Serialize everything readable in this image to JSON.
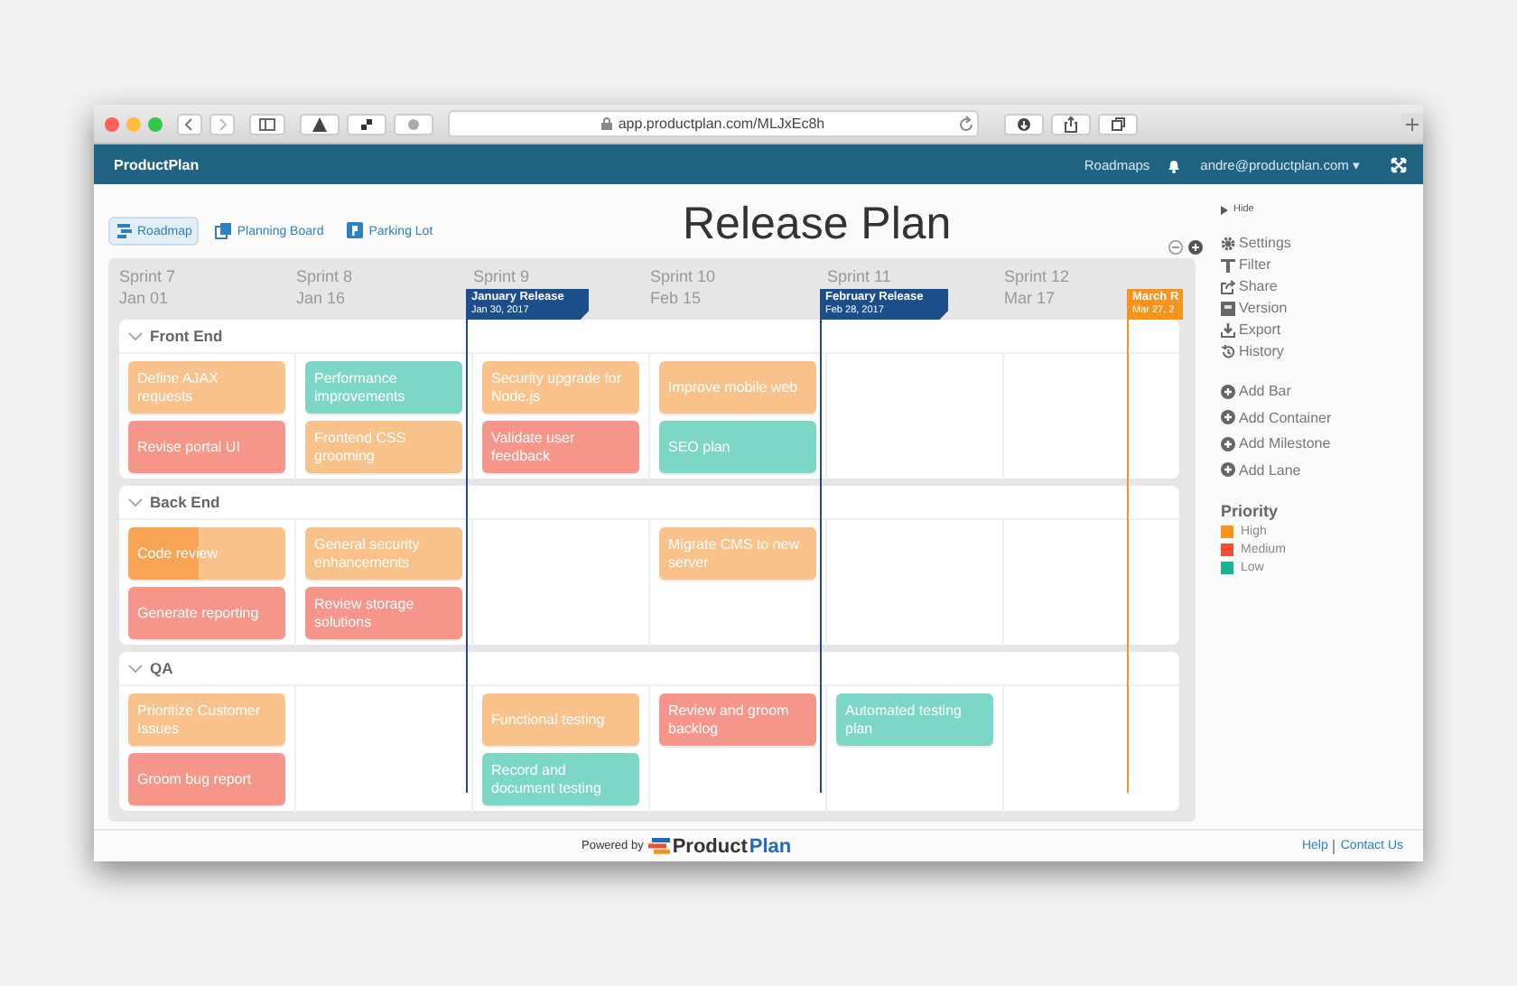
{
  "browser": {
    "url": "app.productplan.com/MLJxEc8h"
  },
  "navbar": {
    "brand": "ProductPlan",
    "links": [
      "Roadmaps"
    ],
    "user": "andre@productplan.com ▾"
  },
  "views": [
    {
      "label": "Roadmap",
      "selected": true
    },
    {
      "label": "Planning Board",
      "selected": false
    },
    {
      "label": "Parking Lot",
      "selected": false
    }
  ],
  "title": "Release Plan",
  "sprints": [
    {
      "name": "Sprint 7",
      "date": "Jan 01"
    },
    {
      "name": "Sprint 8",
      "date": "Jan 16"
    },
    {
      "name": "Sprint 9",
      "milestone": {
        "title": "January Release",
        "date": "Jan 30, 2017",
        "color": "#1d4e8c",
        "kind": "notched"
      }
    },
    {
      "name": "Sprint 10",
      "date": "Feb 15"
    },
    {
      "name": "Sprint 11",
      "milestone": {
        "title": "February Release",
        "date": "Feb 28, 2017",
        "color": "#1d4e8c",
        "kind": "notched"
      }
    },
    {
      "name": "Sprint 12",
      "date": "Mar 17",
      "milestone": {
        "title": "March R",
        "date": "Mar 27, 2",
        "color": "#f7941d",
        "kind": "plain"
      }
    }
  ],
  "lanes": [
    {
      "name": "Front End",
      "expanded": true,
      "columns": [
        [
          {
            "text": "Define AJAX requests",
            "color": "#f8c28a"
          },
          {
            "text": "Revise portal UI",
            "color": "#f6968a"
          }
        ],
        [
          {
            "text": "Performance improvements",
            "color": "#7dd7c6"
          },
          {
            "text": "Frontend CSS grooming",
            "color": "#f8c28a"
          }
        ],
        [
          {
            "text": "Security upgrade for Node.js",
            "color": "#f8c28a"
          },
          {
            "text": "Validate user feedback",
            "color": "#f6968a"
          }
        ],
        [
          {
            "text": "Improve mobile web",
            "color": "#f8c28a"
          },
          {
            "text": "SEO plan",
            "color": "#7dd7c6"
          }
        ],
        [],
        []
      ]
    },
    {
      "name": "Back End",
      "expanded": true,
      "columns": [
        [
          {
            "text": "Code review",
            "color": "#f8c28a",
            "level": 0.45
          },
          {
            "text": "Generate reporting",
            "color": "#f6968a"
          }
        ],
        [
          {
            "text": "General security enhancements",
            "color": "#f8c28a"
          },
          {
            "text": "Review storage solutions",
            "color": "#f6968a"
          }
        ],
        [],
        [
          {
            "text": "Migrate CMS to new server",
            "color": "#f8c28a"
          }
        ],
        [],
        []
      ]
    },
    {
      "name": "QA",
      "expanded": true,
      "columns": [
        [
          {
            "text": "Prioritize Customer Issues",
            "color": "#f8c28a"
          },
          {
            "text": "Groom bug report",
            "color": "#f6968a"
          }
        ],
        [],
        [
          {
            "text": "Functional testing",
            "color": "#f8c28a"
          },
          {
            "text": "Record and document testing",
            "color": "#7dd7c6"
          }
        ],
        [
          {
            "text": "Review and groom backlog",
            "color": "#f6968a"
          }
        ],
        [
          {
            "text": "Automated testing plan",
            "color": "#7dd7c6"
          }
        ],
        []
      ]
    }
  ],
  "sidebar": {
    "hide": "Hide",
    "actions": [
      {
        "label": "Settings",
        "kind": "gear"
      },
      {
        "label": "Filter",
        "kind": "filter"
      },
      {
        "label": "Share",
        "kind": "share"
      },
      {
        "label": "Version",
        "kind": "version"
      },
      {
        "label": "Export",
        "kind": "export"
      },
      {
        "label": "History",
        "kind": "history"
      }
    ],
    "adds": [
      "Add Bar",
      "Add Container",
      "Add Milestone",
      "Add Lane"
    ],
    "legend_title": "Priority",
    "legend": [
      {
        "label": "High",
        "color": "#f7941d"
      },
      {
        "label": "Medium",
        "color": "#f04e37"
      },
      {
        "label": "Low",
        "color": "#1ab394"
      }
    ]
  },
  "footer": {
    "powered": "Powered by",
    "logo_a": "Product",
    "logo_b": "Plan",
    "links": [
      "Help",
      "Contact Us"
    ]
  }
}
